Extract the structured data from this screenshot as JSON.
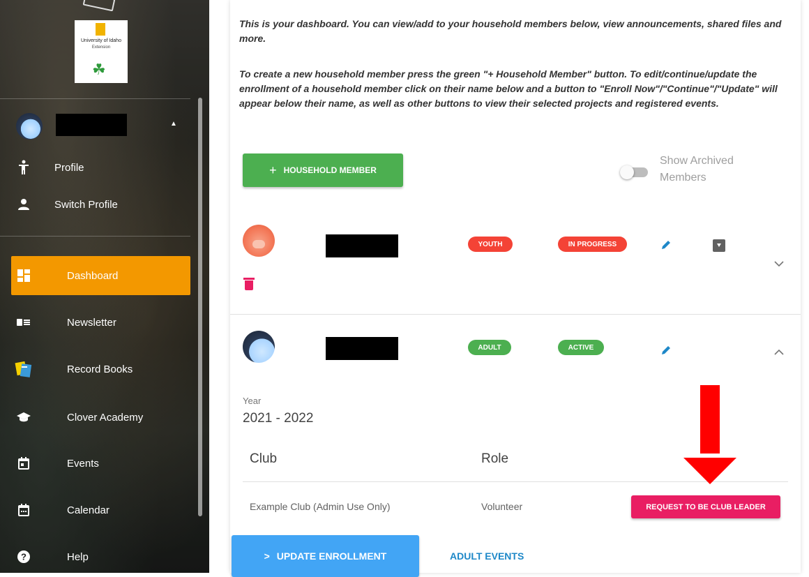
{
  "sidebar": {
    "logo": {
      "line1": "University of Idaho",
      "line2": "Extension"
    },
    "nav": [
      {
        "label": "Profile",
        "icon": "person-walking-icon"
      },
      {
        "label": "Switch Profile",
        "icon": "person-icon"
      },
      {
        "label": "Dashboard",
        "icon": "dashboard-icon"
      },
      {
        "label": "Newsletter",
        "icon": "newsletter-icon"
      },
      {
        "label": "Record Books",
        "icon": "record-books-icon"
      },
      {
        "label": "Clover Academy",
        "icon": "graduation-cap-icon"
      },
      {
        "label": "Events",
        "icon": "event-icon"
      },
      {
        "label": "Calendar",
        "icon": "calendar-icon"
      },
      {
        "label": "Help",
        "icon": "help-icon"
      }
    ],
    "active_color": "#f39800"
  },
  "main": {
    "intro_1": "This is your dashboard. You can view/add to your household members below, view announcements, shared files and more.",
    "intro_2": "To create a new household member press the green \"+ Household Member\" button. To edit/continue/update the enrollment of a household member click on their name below and a button to \"Enroll Now\"/\"Continue\"/\"Update\" will appear below their name, as well as other buttons to view their selected projects and registered events.",
    "add_member_label": "HOUSEHOLD MEMBER",
    "show_archived_label": "Show Archived Members",
    "members": [
      {
        "type": "YOUTH",
        "status": "IN PROGRESS"
      },
      {
        "type": "ADULT",
        "status": "ACTIVE"
      }
    ],
    "enrollment": {
      "year_label": "Year",
      "year_value": "2021 - 2022",
      "columns": [
        "Club",
        "Role"
      ],
      "rows": [
        {
          "club": "Example Club (Admin Use Only)",
          "role": "Volunteer"
        }
      ],
      "leader_button": "REQUEST TO BE CLUB LEADER"
    },
    "update_button": "UPDATE ENROLLMENT",
    "update_button_prefix": ">",
    "adult_events_link": "ADULT EVENTS"
  },
  "colors": {
    "green": "#4caf50",
    "red": "#f44336",
    "pink": "#e91e63",
    "blue": "#42a5f5",
    "link": "#1e88c8",
    "annotation_arrow": "#ff0000"
  }
}
